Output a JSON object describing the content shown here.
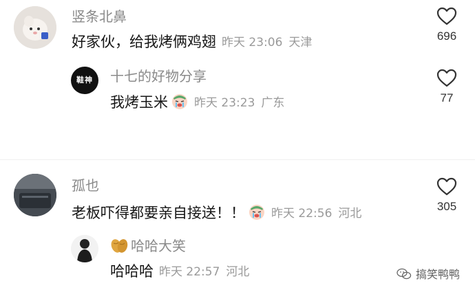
{
  "comments": [
    {
      "user": "竖条北鼻",
      "text": "好家伙，给我烤俩鸡翅",
      "time": "昨天 23:06",
      "location": "天津",
      "likes": "696",
      "reply": {
        "user": "十七的好物分享",
        "avatar_text": "鞋神",
        "text": "我烤玉米",
        "time": "昨天 23:23",
        "location": "广东",
        "likes": "77"
      }
    },
    {
      "user": "孤也",
      "text": "老板吓得都要亲自接送！！",
      "time": "昨天 22:56",
      "location": "河北",
      "likes": "305",
      "reply": {
        "user": "哈哈大笑",
        "text": "哈哈哈",
        "time": "昨天 22:57",
        "location": "河北"
      }
    }
  ],
  "watermark": "搞笑鸭鸭",
  "icons": {
    "heart": "heart-outline-icon",
    "crying_emoji": "crying-face-emoji",
    "peanut": "peanut-emoji"
  },
  "colors": {
    "username": "#8a8a8a",
    "meta": "#9a9a9a",
    "text": "#161616"
  }
}
